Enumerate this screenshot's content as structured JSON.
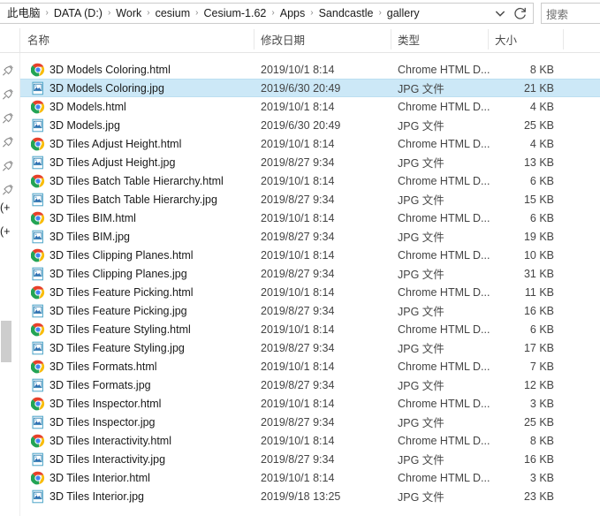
{
  "window": {
    "breadcrumb": [
      "此电脑",
      "DATA (D:)",
      "Work",
      "cesium",
      "Cesium-1.62",
      "Apps",
      "Sandcastle",
      "gallery"
    ],
    "breadcrumb_separator": "›",
    "search_text": "搜索",
    "chevron_icon": "chevron-down-icon",
    "refresh_icon": "refresh-icon"
  },
  "columns": {
    "name": "名称",
    "date_modified": "修改日期",
    "type": "类型",
    "size": "大小",
    "sort_column": "名称",
    "sort_direction": "ascending"
  },
  "nav_pane": {
    "pin_icon": "pin-icon",
    "pin_count": 6,
    "clipped_labels": [
      "(+",
      "(+"
    ]
  },
  "file_list": {
    "rows": [
      {
        "name": "3D Models Coloring.html",
        "date": "2019/10/1 8:14",
        "type": "Chrome HTML D...",
        "size": "8 KB",
        "icon": "chrome-icon",
        "selected": false
      },
      {
        "name": "3D Models Coloring.jpg",
        "date": "2019/6/30 20:49",
        "type": "JPG 文件",
        "size": "21 KB",
        "icon": "image-file-icon",
        "selected": true
      },
      {
        "name": "3D Models.html",
        "date": "2019/10/1 8:14",
        "type": "Chrome HTML D...",
        "size": "4 KB",
        "icon": "chrome-icon",
        "selected": false
      },
      {
        "name": "3D Models.jpg",
        "date": "2019/6/30 20:49",
        "type": "JPG 文件",
        "size": "25 KB",
        "icon": "image-file-icon",
        "selected": false
      },
      {
        "name": "3D Tiles Adjust Height.html",
        "date": "2019/10/1 8:14",
        "type": "Chrome HTML D...",
        "size": "4 KB",
        "icon": "chrome-icon",
        "selected": false
      },
      {
        "name": "3D Tiles Adjust Height.jpg",
        "date": "2019/8/27 9:34",
        "type": "JPG 文件",
        "size": "13 KB",
        "icon": "image-file-icon",
        "selected": false
      },
      {
        "name": "3D Tiles Batch Table Hierarchy.html",
        "date": "2019/10/1 8:14",
        "type": "Chrome HTML D...",
        "size": "6 KB",
        "icon": "chrome-icon",
        "selected": false
      },
      {
        "name": "3D Tiles Batch Table Hierarchy.jpg",
        "date": "2019/8/27 9:34",
        "type": "JPG 文件",
        "size": "15 KB",
        "icon": "image-file-icon",
        "selected": false
      },
      {
        "name": "3D Tiles BIM.html",
        "date": "2019/10/1 8:14",
        "type": "Chrome HTML D...",
        "size": "6 KB",
        "icon": "chrome-icon",
        "selected": false
      },
      {
        "name": "3D Tiles BIM.jpg",
        "date": "2019/8/27 9:34",
        "type": "JPG 文件",
        "size": "19 KB",
        "icon": "image-file-icon",
        "selected": false
      },
      {
        "name": "3D Tiles Clipping Planes.html",
        "date": "2019/10/1 8:14",
        "type": "Chrome HTML D...",
        "size": "10 KB",
        "icon": "chrome-icon",
        "selected": false
      },
      {
        "name": "3D Tiles Clipping Planes.jpg",
        "date": "2019/8/27 9:34",
        "type": "JPG 文件",
        "size": "31 KB",
        "icon": "image-file-icon",
        "selected": false
      },
      {
        "name": "3D Tiles Feature Picking.html",
        "date": "2019/10/1 8:14",
        "type": "Chrome HTML D...",
        "size": "11 KB",
        "icon": "chrome-icon",
        "selected": false
      },
      {
        "name": "3D Tiles Feature Picking.jpg",
        "date": "2019/8/27 9:34",
        "type": "JPG 文件",
        "size": "16 KB",
        "icon": "image-file-icon",
        "selected": false
      },
      {
        "name": "3D Tiles Feature Styling.html",
        "date": "2019/10/1 8:14",
        "type": "Chrome HTML D...",
        "size": "6 KB",
        "icon": "chrome-icon",
        "selected": false
      },
      {
        "name": "3D Tiles Feature Styling.jpg",
        "date": "2019/8/27 9:34",
        "type": "JPG 文件",
        "size": "17 KB",
        "icon": "image-file-icon",
        "selected": false
      },
      {
        "name": "3D Tiles Formats.html",
        "date": "2019/10/1 8:14",
        "type": "Chrome HTML D...",
        "size": "7 KB",
        "icon": "chrome-icon",
        "selected": false
      },
      {
        "name": "3D Tiles Formats.jpg",
        "date": "2019/8/27 9:34",
        "type": "JPG 文件",
        "size": "12 KB",
        "icon": "image-file-icon",
        "selected": false
      },
      {
        "name": "3D Tiles Inspector.html",
        "date": "2019/10/1 8:14",
        "type": "Chrome HTML D...",
        "size": "3 KB",
        "icon": "chrome-icon",
        "selected": false
      },
      {
        "name": "3D Tiles Inspector.jpg",
        "date": "2019/8/27 9:34",
        "type": "JPG 文件",
        "size": "25 KB",
        "icon": "image-file-icon",
        "selected": false
      },
      {
        "name": "3D Tiles Interactivity.html",
        "date": "2019/10/1 8:14",
        "type": "Chrome HTML D...",
        "size": "8 KB",
        "icon": "chrome-icon",
        "selected": false
      },
      {
        "name": "3D Tiles Interactivity.jpg",
        "date": "2019/8/27 9:34",
        "type": "JPG 文件",
        "size": "16 KB",
        "icon": "image-file-icon",
        "selected": false
      },
      {
        "name": "3D Tiles Interior.html",
        "date": "2019/10/1 8:14",
        "type": "Chrome HTML D...",
        "size": "3 KB",
        "icon": "chrome-icon",
        "selected": false
      },
      {
        "name": "3D Tiles Interior.jpg",
        "date": "2019/9/18 13:25",
        "type": "JPG 文件",
        "size": "23 KB",
        "icon": "image-file-icon",
        "selected": false
      }
    ]
  },
  "colors": {
    "selection": "#cce8f7",
    "selection_border": "#bcdff1",
    "text": "#1a1a1a",
    "secondary_text": "#444444",
    "divider": "#e8e8e8"
  }
}
